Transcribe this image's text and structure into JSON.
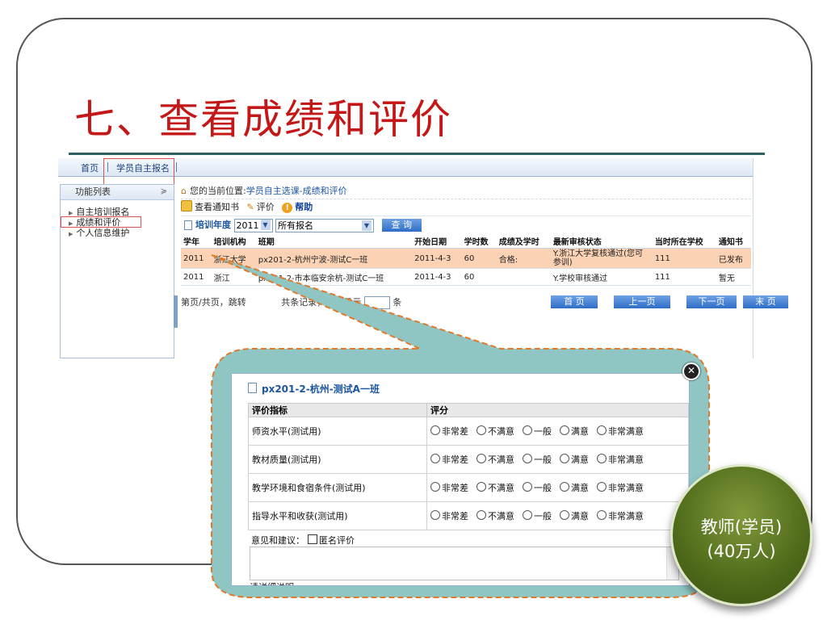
{
  "slide": {
    "title": "七、查看成绩和评价"
  },
  "nav": {
    "items": [
      "首页",
      "学员自主报名"
    ]
  },
  "sidebar": {
    "header": "功能列表",
    "items": [
      "自主培训报名",
      "成绩和评价",
      "个人信息维护"
    ]
  },
  "breadcrumb": {
    "prefix": "您的当前位置:",
    "path": "学员自主选课-成绩和评价"
  },
  "toolbar": {
    "notice": "查看通知书",
    "evaluate": "评价",
    "help": "帮助"
  },
  "filter": {
    "label": "培训年度",
    "year": "2011",
    "signup": "所有报名",
    "query": "查 询"
  },
  "table": {
    "headers": [
      "学年",
      "培训机构",
      "班期",
      "开始日期",
      "学时数",
      "成绩及学时",
      "最新审核状态",
      "当时所在学校",
      "通知书"
    ],
    "rows": [
      [
        "2011",
        "浙江大学",
        "px201-2-杭州宁波-测试C一班",
        "2011-4-3",
        "60",
        "合格:",
        "Y.浙江大学复核通过(您可参训)",
        "111",
        "已发布"
      ],
      [
        "2011",
        "浙江",
        "px201-2-市本临安余杭-测试C一班",
        "2011-4-3",
        "60",
        "",
        "Y.学校审核通过",
        "111",
        "暂无"
      ]
    ]
  },
  "pager": {
    "text1": "第页/共页，跳转",
    "text2": "共条记录，每页显示",
    "text3": "条",
    "first": "首 页",
    "prev": "上一页",
    "next": "下一页",
    "last": "末 页"
  },
  "dialog": {
    "title": "px201-2-杭州-测试A一班",
    "col1": "评价指标",
    "col2": "评分",
    "options": [
      "非常差",
      "不满意",
      "一般",
      "满意",
      "非常满意"
    ],
    "criteria": [
      "师资水平(测试用)",
      "教材质量(测试用)",
      "教学环境和食宿条件(测试用)",
      "指导水平和收获(测试用)"
    ],
    "comment_label": "意见和建议：",
    "anonymous": "匿名评价",
    "cut_text": "请详细说明"
  },
  "badge": {
    "line1": "教师(学员)",
    "line2": "(40万人)"
  },
  "colors": {
    "title": "#c41818",
    "callout_fill": "#8fc6c4",
    "callout_border": "#e07a2a",
    "badge": "#5a7520",
    "highlight_row": "#fbd3b4"
  }
}
